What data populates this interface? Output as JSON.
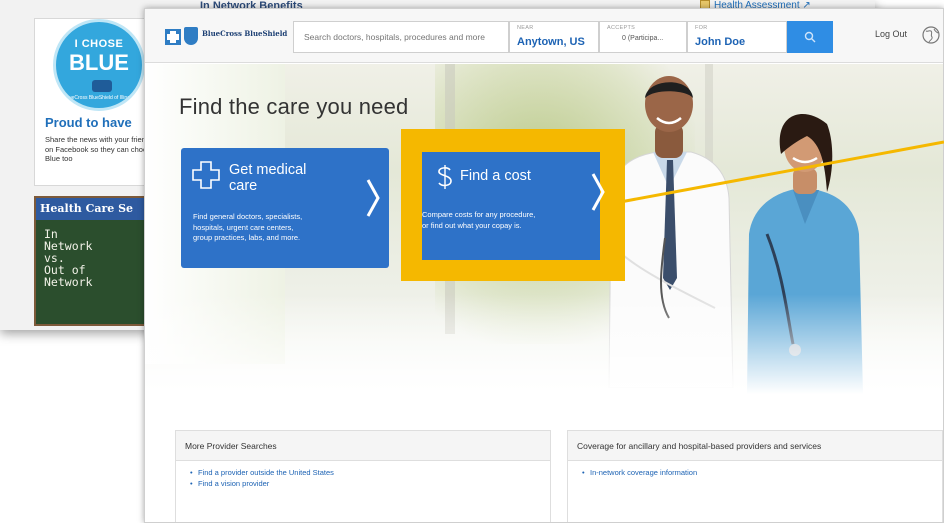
{
  "background_shot": {
    "top_heading": "In Network Benefits",
    "health_link": "Health Assessment",
    "badge": {
      "line1": "I CHOSE",
      "line2": "BLUE",
      "sub": "BlueCross BlueShield of Illinois"
    },
    "proud_title": "Proud to have",
    "share_text": "Share the news with your friends on Facebook so they can choose Blue too",
    "hcs_title": "Health Care Se",
    "hcs_chalk": "In\nNetwork\nvs.\nOut of\nNetwork"
  },
  "header": {
    "logo_text": "BlueCross BlueShield",
    "search_placeholder": "Search doctors, hospitals, procedures and more",
    "near_label": "NEAR",
    "near_value": "Anytown, US",
    "accepts_label": "ACCEPTS",
    "accepts_value": "0 (Participa...",
    "for_label": "FOR",
    "for_value": "John Doe",
    "logout": "Log Out"
  },
  "hero": {
    "title": "Find the care you need"
  },
  "cards": {
    "medical": {
      "title_line1": "Get medical",
      "title_line2": "care",
      "desc_line1": "Find general doctors, specialists,",
      "desc_line2": "hospitals, urgent care centers,",
      "desc_line3": "group practices, labs, and more."
    },
    "cost": {
      "title": "Find a cost",
      "desc_line1": "Compare costs for any procedure,",
      "desc_line2": "or find out what your copay is."
    }
  },
  "panels": {
    "more": {
      "title": "More Provider Searches",
      "links": [
        "Find a provider outside the United States",
        "Find a vision provider"
      ]
    },
    "coverage": {
      "title": "Coverage for ancillary and hospital-based providers and services",
      "links": [
        "In-network coverage information"
      ]
    }
  },
  "colors": {
    "brand_blue": "#2e72c8",
    "highlight": "#f5b800",
    "link": "#1d63b4"
  }
}
